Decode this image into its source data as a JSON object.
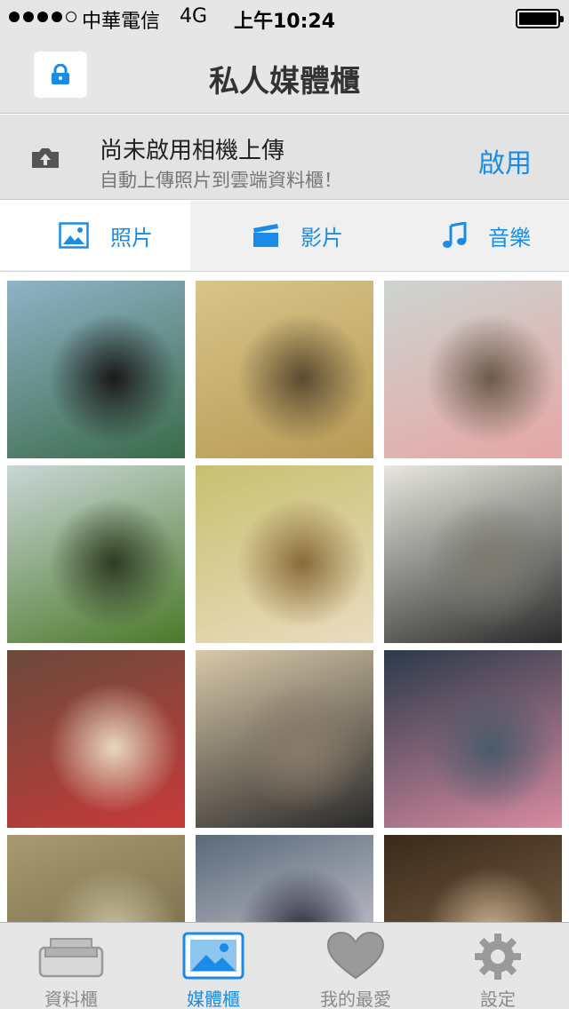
{
  "status_bar": {
    "carrier": "中華電信",
    "network": "4G",
    "time": "上午10:24",
    "signal_bars": 4,
    "signal_total": 5,
    "battery_level": 1.0
  },
  "nav": {
    "title": "私人媒體櫃",
    "lock_icon": "lock-icon"
  },
  "upload_banner": {
    "title": "尚未啟用相機上傳",
    "subtitle": "自動上傳照片到雲端資料櫃！",
    "action": "啟用",
    "icon": "camera-upload-icon"
  },
  "tabs": [
    {
      "label": "照片",
      "icon": "photo-icon",
      "active": true
    },
    {
      "label": "影片",
      "icon": "clapperboard-icon",
      "active": false
    },
    {
      "label": "音樂",
      "icon": "music-note-icon",
      "active": false
    }
  ],
  "photos": [
    {
      "subject": "gorilla-figure",
      "colors": [
        "#8fb3c8",
        "#3b6b4a",
        "#1a1a1a"
      ]
    },
    {
      "subject": "cat-sketches",
      "colors": [
        "#d9c48a",
        "#b89a55",
        "#5a4a30"
      ]
    },
    {
      "subject": "cat-cake",
      "colors": [
        "#cdd4cf",
        "#e6a6a6",
        "#6a5a4a"
      ]
    },
    {
      "subject": "cat-in-garden",
      "colors": [
        "#c9d6d6",
        "#4b7a2a",
        "#2e3a22"
      ]
    },
    {
      "subject": "kitten-closeup",
      "colors": [
        "#c8c070",
        "#eadcc0",
        "#8a6a3a"
      ]
    },
    {
      "subject": "araki-book",
      "colors": [
        "#e8e8e0",
        "#2a2a2a",
        "#7a7a70"
      ]
    },
    {
      "subject": "ice-cream-dessert",
      "colors": [
        "#6a4a3a",
        "#c83a3a",
        "#e8d8c0"
      ]
    },
    {
      "subject": "cat-figurine-tickets",
      "colors": [
        "#d8c8a8",
        "#2a2a2a",
        "#8a7a6a"
      ]
    },
    {
      "subject": "hippo-toy",
      "colors": [
        "#2a3a4a",
        "#d88aa0",
        "#4a5a6a"
      ]
    },
    {
      "subject": "landscape-painting",
      "colors": [
        "#a89a70",
        "#6a6040",
        "#c8c0a0"
      ]
    },
    {
      "subject": "toy-keychain",
      "colors": [
        "#5a6a7a",
        "#e8e0e8",
        "#2a2a3a"
      ]
    },
    {
      "subject": "stage-figure",
      "colors": [
        "#3a2a1a",
        "#8a7050",
        "#c8b090"
      ]
    }
  ],
  "tab_bar": [
    {
      "label": "資料櫃",
      "icon": "cabinet-icon",
      "active": false
    },
    {
      "label": "媒體櫃",
      "icon": "media-icon",
      "active": true
    },
    {
      "label": "我的最愛",
      "icon": "heart-icon",
      "active": false
    },
    {
      "label": "設定",
      "icon": "gear-icon",
      "active": false
    }
  ],
  "colors": {
    "accent": "#1a8ce8",
    "bar_background": "#e6e6e6",
    "inactive": "#8a8a8a"
  }
}
